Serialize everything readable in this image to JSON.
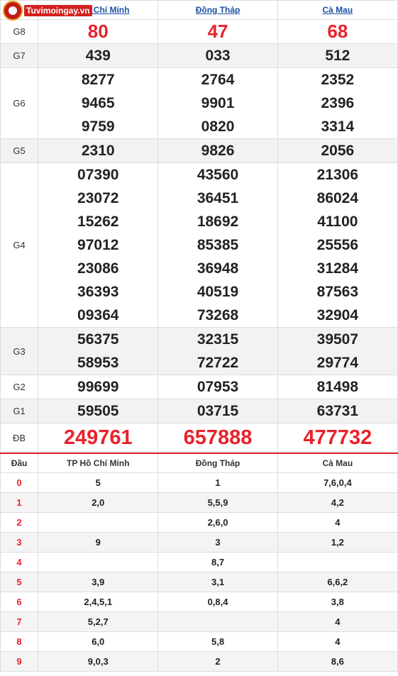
{
  "header": {
    "logo_text": "Tuvimoingay.vn",
    "provinces": [
      "TP Hồ Chí Minh",
      "Đồng Tháp",
      "Cà Mau"
    ]
  },
  "prizes": [
    {
      "label": "G8",
      "values": [
        [
          "80"
        ],
        [
          "47"
        ],
        [
          "68"
        ]
      ]
    },
    {
      "label": "G7",
      "values": [
        [
          "439"
        ],
        [
          "033"
        ],
        [
          "512"
        ]
      ]
    },
    {
      "label": "G6",
      "values": [
        [
          "8277",
          "9465",
          "9759"
        ],
        [
          "2764",
          "9901",
          "0820"
        ],
        [
          "2352",
          "2396",
          "3314"
        ]
      ]
    },
    {
      "label": "G5",
      "values": [
        [
          "2310"
        ],
        [
          "9826"
        ],
        [
          "2056"
        ]
      ]
    },
    {
      "label": "G4",
      "values": [
        [
          "07390",
          "23072",
          "15262",
          "97012",
          "23086",
          "36393",
          "09364"
        ],
        [
          "43560",
          "36451",
          "18692",
          "85385",
          "36948",
          "40519",
          "73268"
        ],
        [
          "21306",
          "86024",
          "41100",
          "25556",
          "31284",
          "87563",
          "32904"
        ]
      ]
    },
    {
      "label": "G3",
      "values": [
        [
          "56375",
          "58953"
        ],
        [
          "32315",
          "72722"
        ],
        [
          "39507",
          "29774"
        ]
      ]
    },
    {
      "label": "G2",
      "values": [
        [
          "99699"
        ],
        [
          "07953"
        ],
        [
          "81498"
        ]
      ]
    },
    {
      "label": "G1",
      "values": [
        [
          "59505"
        ],
        [
          "03715"
        ],
        [
          "63731"
        ]
      ]
    },
    {
      "label": "ĐB",
      "values": [
        [
          "249761"
        ],
        [
          "657888"
        ],
        [
          "477732"
        ]
      ]
    }
  ],
  "loto": {
    "headers": [
      "Đầu",
      "TP Hồ Chí Minh",
      "Đồng Tháp",
      "Cà Mau"
    ],
    "rows": [
      [
        "0",
        "5",
        "1",
        "7,6,0,4"
      ],
      [
        "1",
        "2,0",
        "5,5,9",
        "4,2"
      ],
      [
        "2",
        "",
        "2,6,0",
        "4"
      ],
      [
        "3",
        "9",
        "3",
        "1,2"
      ],
      [
        "4",
        "",
        "8,7",
        ""
      ],
      [
        "5",
        "3,9",
        "3,1",
        "6,6,2"
      ],
      [
        "6",
        "2,4,5,1",
        "0,8,4",
        "3,8"
      ],
      [
        "7",
        "5,2,7",
        "",
        "4"
      ],
      [
        "8",
        "6,0",
        "5,8",
        "4"
      ],
      [
        "9",
        "9,0,3",
        "2",
        "8,6"
      ]
    ]
  },
  "colors": {
    "accent_red": "#e8232b",
    "link_blue": "#1a4fa3"
  }
}
